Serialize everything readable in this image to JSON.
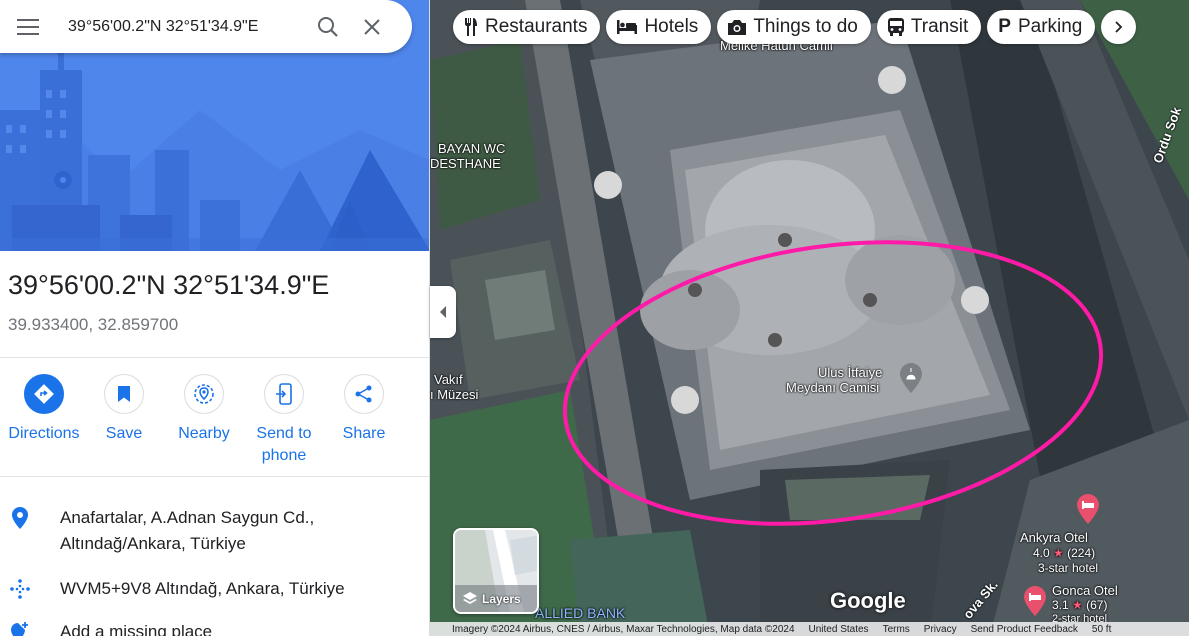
{
  "search": {
    "value": "39°56'00.2\"N 32°51'34.9\"E"
  },
  "place": {
    "title": "39°56'00.2\"N 32°51'34.9\"E",
    "decimal": "39.933400, 32.859700"
  },
  "actions": [
    {
      "label": "Directions",
      "icon": "directions-icon"
    },
    {
      "label": "Save",
      "icon": "bookmark-icon"
    },
    {
      "label": "Nearby",
      "icon": "nearby-icon"
    },
    {
      "label": "Send to phone",
      "icon": "send-to-phone-icon"
    },
    {
      "label": "Share",
      "icon": "share-icon"
    }
  ],
  "info": {
    "address": "Anafartalar, A.Adnan Saygun Cd., Altındağ/Ankara, Türkiye",
    "plus_code": "WVM5+9V8 Altındağ, Ankara, Türkiye",
    "add_place": "Add a missing place"
  },
  "chips": [
    {
      "label": "Restaurants",
      "icon": "fork-knife-icon"
    },
    {
      "label": "Hotels",
      "icon": "bed-icon"
    },
    {
      "label": "Things to do",
      "icon": "camera-icon"
    },
    {
      "label": "Transit",
      "icon": "bus-icon"
    },
    {
      "label": "Parking",
      "icon": "parking-icon"
    }
  ],
  "map_labels": {
    "mosque_top": "Melike Hatun Camii",
    "wc": "BAYAN WC",
    "wc2": "DESTHANE",
    "vakif": "Vakıf",
    "muzesi": "ı Müzesi",
    "mosque_main_1": "Ulus İtfaiye",
    "mosque_main_2": "Meydanı Camisi",
    "street_right": "Ordu Sok",
    "street_bottom": "ova Sk.",
    "bank": "ALLIED BANK",
    "hotel1_name": "Ankyra Otel",
    "hotel1_rating": "4.0",
    "hotel1_count": "(224)",
    "hotel1_class": "3-star hotel",
    "hotel2_name": "Gonca Otel",
    "hotel2_rating": "3.1",
    "hotel2_count": "(67)",
    "hotel2_class": "2-star hotel"
  },
  "layers_label": "Layers",
  "google_logo": "Google",
  "footer": {
    "imagery": "Imagery ©2024 Airbus, CNES / Airbus, Maxar Technologies, Map data ©2024",
    "country": "United States",
    "terms": "Terms",
    "privacy": "Privacy",
    "feedback": "Send Product Feedback",
    "scale": "50 ft"
  },
  "colors": {
    "accent": "#1a73e8",
    "highlight_ellipse": "#ff1aa8",
    "hotel_pin": "#e8506d"
  }
}
